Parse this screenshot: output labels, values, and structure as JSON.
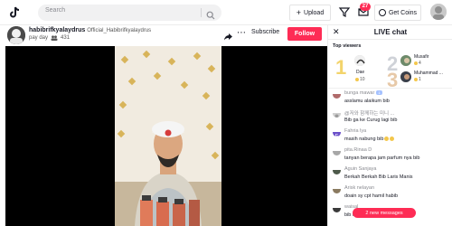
{
  "header": {
    "search_placeholder": "Search",
    "upload_label": "Upload",
    "plus_glyph": "+",
    "notification_count": "27",
    "coins_label": "Get Coins",
    "icons": [
      "logo-icon",
      "search-icon",
      "filter-icon",
      "inbox-icon",
      "coin-icon"
    ]
  },
  "stream": {
    "host_name": "habibrifkyalaydrus",
    "host_handle": "Official_Habibrifkyalaydrus",
    "host_subtitle": "pay day",
    "viewer_count": "431",
    "more_glyph": "⋯",
    "subscribe_label": "Subscribe",
    "follow_label": "Follow",
    "accent_color": "#fe2c55"
  },
  "chat": {
    "close_glyph": "✕",
    "title": "LIVE chat",
    "top_viewers_label": "Top viewers",
    "top_viewers": [
      {
        "rank": "1",
        "name": "Dae",
        "score": "10"
      },
      {
        "rank": "2",
        "name": "Musafir",
        "score": "4"
      },
      {
        "rank": "3",
        "name": "Muhammad ...",
        "score": "1"
      }
    ],
    "messages": [
      {
        "user": "bunga mawar",
        "badge": "1",
        "text": "asslamu alaikum bib"
      },
      {
        "user": "@저와 함께하는 미니 ...",
        "text": "Bib ga ke Curug lagi bib"
      },
      {
        "user": "Fahria lya",
        "text": "masih nabung bib"
      },
      {
        "user": "pita.Rinaa D",
        "text": "tanyan berapa jam parfum nya bib"
      },
      {
        "user": "Aguin Sanjaya",
        "text": "Berkah Berkah Bib Laris Manis"
      },
      {
        "user": "Arisk nelayan",
        "text": "doain sy cpt hamil habib"
      },
      {
        "user": "waisal",
        "text": "bib kenapa ga dari kemarin"
      }
    ],
    "new_messages_label": "2 new messages"
  }
}
